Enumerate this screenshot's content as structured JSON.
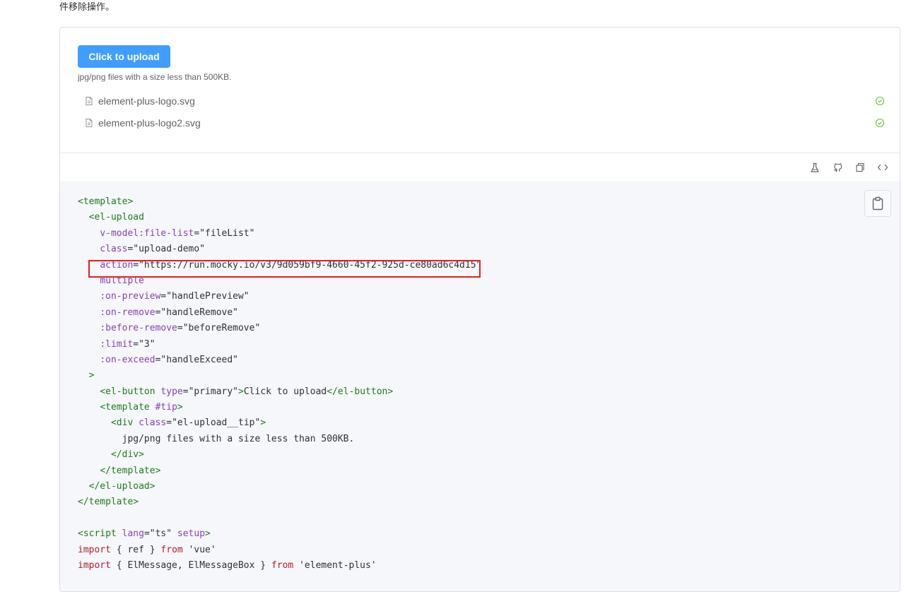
{
  "intro_text": "件移除操作。",
  "upload": {
    "button_label": "Click to upload",
    "tip": "jpg/png files with a size less than 500KB.",
    "files": [
      {
        "name": "element-plus-logo.svg",
        "status_icon": "check-circle-icon"
      },
      {
        "name": "element-plus-logo2.svg",
        "status_icon": "check-circle-icon"
      }
    ]
  },
  "toolbar_icons": [
    "playground-icon",
    "github-icon",
    "copy-icon",
    "code-icon"
  ],
  "colors": {
    "primary": "#409eff",
    "success": "#67c23a",
    "code_bg": "#f5f7fa",
    "tag": "#1e7a1e",
    "attr": "#8a3fb5",
    "keyword": "#b31d28",
    "highlight": "#e02020"
  },
  "code_lines": [
    [
      {
        "t": "tag",
        "v": "<template>"
      }
    ],
    [
      {
        "t": "txt",
        "v": "  "
      },
      {
        "t": "tag",
        "v": "<el-upload"
      }
    ],
    [
      {
        "t": "txt",
        "v": "    "
      },
      {
        "t": "attr",
        "v": "v-model:file-list"
      },
      {
        "t": "punc",
        "v": "="
      },
      {
        "t": "str",
        "v": "\"fileList\""
      }
    ],
    [
      {
        "t": "txt",
        "v": "    "
      },
      {
        "t": "attr",
        "v": "class"
      },
      {
        "t": "punc",
        "v": "="
      },
      {
        "t": "str",
        "v": "\"upload-demo\""
      }
    ],
    [
      {
        "t": "txt",
        "v": "    "
      },
      {
        "t": "attr",
        "v": "action"
      },
      {
        "t": "punc",
        "v": "="
      },
      {
        "t": "str",
        "v": "\"https://run.mocky.io/v3/9d059bf9-4660-45f2-925d-ce80ad6c4d15\""
      }
    ],
    [
      {
        "t": "txt",
        "v": "    "
      },
      {
        "t": "attr",
        "v": "multiple"
      }
    ],
    [
      {
        "t": "txt",
        "v": "    "
      },
      {
        "t": "attr",
        "v": ":on-preview"
      },
      {
        "t": "punc",
        "v": "="
      },
      {
        "t": "str",
        "v": "\"handlePreview\""
      }
    ],
    [
      {
        "t": "txt",
        "v": "    "
      },
      {
        "t": "attr",
        "v": ":on-remove"
      },
      {
        "t": "punc",
        "v": "="
      },
      {
        "t": "str",
        "v": "\"handleRemove\""
      }
    ],
    [
      {
        "t": "txt",
        "v": "    "
      },
      {
        "t": "attr",
        "v": ":before-remove"
      },
      {
        "t": "punc",
        "v": "="
      },
      {
        "t": "str",
        "v": "\"beforeRemove\""
      }
    ],
    [
      {
        "t": "txt",
        "v": "    "
      },
      {
        "t": "attr",
        "v": ":limit"
      },
      {
        "t": "punc",
        "v": "="
      },
      {
        "t": "str",
        "v": "\"3\""
      }
    ],
    [
      {
        "t": "txt",
        "v": "    "
      },
      {
        "t": "attr",
        "v": ":on-exceed"
      },
      {
        "t": "punc",
        "v": "="
      },
      {
        "t": "str",
        "v": "\"handleExceed\""
      }
    ],
    [
      {
        "t": "txt",
        "v": "  "
      },
      {
        "t": "tag",
        "v": ">"
      }
    ],
    [
      {
        "t": "txt",
        "v": "    "
      },
      {
        "t": "tag",
        "v": "<el-button"
      },
      {
        "t": "txt",
        "v": " "
      },
      {
        "t": "attr",
        "v": "type"
      },
      {
        "t": "punc",
        "v": "="
      },
      {
        "t": "str",
        "v": "\"primary\""
      },
      {
        "t": "tag",
        "v": ">"
      },
      {
        "t": "txt",
        "v": "Click to upload"
      },
      {
        "t": "tag",
        "v": "</el-button>"
      }
    ],
    [
      {
        "t": "txt",
        "v": "    "
      },
      {
        "t": "tag",
        "v": "<template"
      },
      {
        "t": "txt",
        "v": " "
      },
      {
        "t": "attr",
        "v": "#tip"
      },
      {
        "t": "tag",
        "v": ">"
      }
    ],
    [
      {
        "t": "txt",
        "v": "      "
      },
      {
        "t": "tag",
        "v": "<div"
      },
      {
        "t": "txt",
        "v": " "
      },
      {
        "t": "attr",
        "v": "class"
      },
      {
        "t": "punc",
        "v": "="
      },
      {
        "t": "str",
        "v": "\"el-upload__tip\""
      },
      {
        "t": "tag",
        "v": ">"
      }
    ],
    [
      {
        "t": "txt",
        "v": "        jpg/png files with a size less than 500KB."
      }
    ],
    [
      {
        "t": "txt",
        "v": "      "
      },
      {
        "t": "tag",
        "v": "</div>"
      }
    ],
    [
      {
        "t": "txt",
        "v": "    "
      },
      {
        "t": "tag",
        "v": "</template>"
      }
    ],
    [
      {
        "t": "txt",
        "v": "  "
      },
      {
        "t": "tag",
        "v": "</el-upload>"
      }
    ],
    [
      {
        "t": "tag",
        "v": "</template>"
      }
    ],
    [
      {
        "t": "txt",
        "v": ""
      }
    ],
    [
      {
        "t": "tag",
        "v": "<script"
      },
      {
        "t": "txt",
        "v": " "
      },
      {
        "t": "attr",
        "v": "lang"
      },
      {
        "t": "punc",
        "v": "="
      },
      {
        "t": "str",
        "v": "\"ts\""
      },
      {
        "t": "txt",
        "v": " "
      },
      {
        "t": "attr",
        "v": "setup"
      },
      {
        "t": "tag",
        "v": ">"
      }
    ],
    [
      {
        "t": "kw",
        "v": "import"
      },
      {
        "t": "txt",
        "v": " { ref } "
      },
      {
        "t": "kw",
        "v": "from"
      },
      {
        "t": "txt",
        "v": " "
      },
      {
        "t": "str",
        "v": "'vue'"
      }
    ],
    [
      {
        "t": "kw",
        "v": "import"
      },
      {
        "t": "txt",
        "v": " { ElMessage, ElMessageBox } "
      },
      {
        "t": "kw",
        "v": "from"
      },
      {
        "t": "txt",
        "v": " "
      },
      {
        "t": "str",
        "v": "'element-plus'"
      }
    ]
  ]
}
